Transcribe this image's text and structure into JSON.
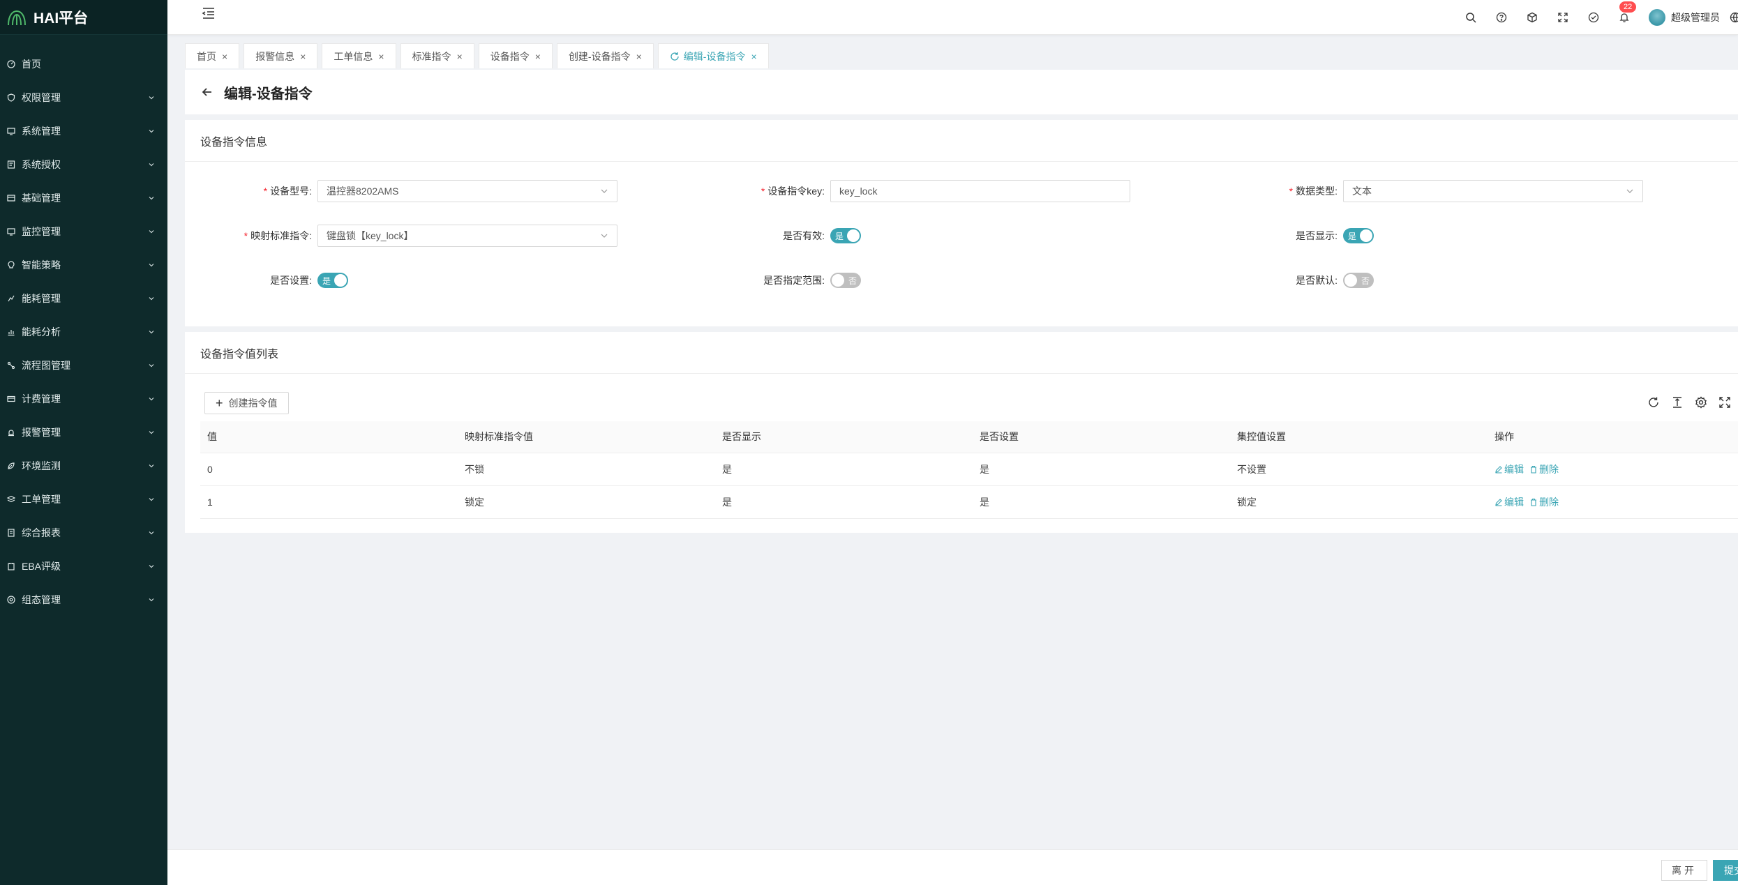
{
  "app": {
    "name": "HAI平台"
  },
  "sidebar": {
    "items": [
      {
        "label": "首页",
        "icon": "dashboard-icon",
        "expandable": false
      },
      {
        "label": "权限管理",
        "icon": "shield-icon",
        "expandable": true
      },
      {
        "label": "系统管理",
        "icon": "monitor-icon",
        "expandable": true
      },
      {
        "label": "系统授权",
        "icon": "license-icon",
        "expandable": true
      },
      {
        "label": "基础管理",
        "icon": "database-icon",
        "expandable": true
      },
      {
        "label": "监控管理",
        "icon": "monitor-icon",
        "expandable": true
      },
      {
        "label": "智能策略",
        "icon": "bulb-icon",
        "expandable": true
      },
      {
        "label": "能耗管理",
        "icon": "energy-icon",
        "expandable": true
      },
      {
        "label": "能耗分析",
        "icon": "chart-icon",
        "expandable": true
      },
      {
        "label": "流程图管理",
        "icon": "flow-icon",
        "expandable": true
      },
      {
        "label": "计费管理",
        "icon": "billing-icon",
        "expandable": true
      },
      {
        "label": "报警管理",
        "icon": "alarm-icon",
        "expandable": true
      },
      {
        "label": "环境监测",
        "icon": "leaf-icon",
        "expandable": true
      },
      {
        "label": "工单管理",
        "icon": "layers-icon",
        "expandable": true
      },
      {
        "label": "综合报表",
        "icon": "report-icon",
        "expandable": true
      },
      {
        "label": "EBA评级",
        "icon": "rating-icon",
        "expandable": true
      },
      {
        "label": "组态管理",
        "icon": "config-icon",
        "expandable": true
      }
    ]
  },
  "header": {
    "notification_count": "22",
    "username": "超级管理员"
  },
  "tabs": [
    {
      "label": "首页",
      "active": false
    },
    {
      "label": "报警信息",
      "active": false
    },
    {
      "label": "工单信息",
      "active": false
    },
    {
      "label": "标准指令",
      "active": false
    },
    {
      "label": "设备指令",
      "active": false
    },
    {
      "label": "创建-设备指令",
      "active": false
    },
    {
      "label": "编辑-设备指令",
      "active": true
    }
  ],
  "page": {
    "title": "编辑-设备指令"
  },
  "info_section": {
    "title": "设备指令信息",
    "device_model": {
      "label": "设备型号",
      "value": "温控器8202AMS"
    },
    "command_key": {
      "label": "设备指令key",
      "value": "key_lock"
    },
    "data_type": {
      "label": "数据类型",
      "value": "文本"
    },
    "mapped_command": {
      "label": "映射标准指令",
      "value": "键盘锁【key_lock】"
    },
    "is_valid": {
      "label": "是否有效",
      "value": "是"
    },
    "is_display": {
      "label": "是否显示",
      "value": "是"
    },
    "is_setting": {
      "label": "是否设置",
      "value": "是"
    },
    "is_range": {
      "label": "是否指定范围",
      "value": "否"
    },
    "is_default": {
      "label": "是否默认",
      "value": "否"
    }
  },
  "list_section": {
    "title": "设备指令值列表",
    "create_button": "创建指令值",
    "columns": [
      "值",
      "映射标准指令值",
      "是否显示",
      "是否设置",
      "集控值设置",
      "操作"
    ],
    "rows": [
      {
        "value": "0",
        "mapped": "不锁",
        "display": "是",
        "setting": "是",
        "central": "不设置"
      },
      {
        "value": "1",
        "mapped": "锁定",
        "display": "是",
        "setting": "是",
        "central": "锁定"
      }
    ],
    "edit_label": "编辑",
    "delete_label": "删除"
  },
  "footer": {
    "leave_label": "离开",
    "submit_label": "提交"
  },
  "colors": {
    "primary": "#3aa5b4",
    "sidebar_bg": "#0e2a2b"
  }
}
